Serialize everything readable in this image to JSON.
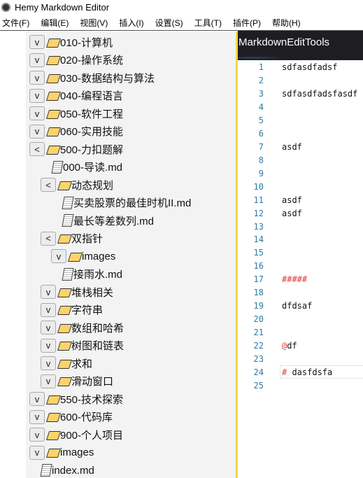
{
  "window": {
    "title": "Hemy Markdown Editor"
  },
  "menu": [
    "文件(F)",
    "编辑(E)",
    "视图(V)",
    "插入(I)",
    "设置(S)",
    "工具(T)",
    "插件(P)",
    "帮助(H)"
  ],
  "tree": [
    {
      "level": 0,
      "type": "folder",
      "toggle": "v",
      "label": "010-计算机"
    },
    {
      "level": 0,
      "type": "folder",
      "toggle": "v",
      "label": "020-操作系统"
    },
    {
      "level": 0,
      "type": "folder",
      "toggle": "v",
      "label": "030-数据结构与算法"
    },
    {
      "level": 0,
      "type": "folder",
      "toggle": "v",
      "label": "040-编程语言"
    },
    {
      "level": 0,
      "type": "folder",
      "toggle": "v",
      "label": "050-软件工程"
    },
    {
      "level": 0,
      "type": "folder",
      "toggle": "v",
      "label": "060-实用技能"
    },
    {
      "level": 0,
      "type": "folder",
      "toggle": "<",
      "label": "500-力扣题解"
    },
    {
      "level": 1,
      "type": "file",
      "label": "000-导读.md"
    },
    {
      "level": 1,
      "type": "folder",
      "toggle": "<",
      "label": "动态规划"
    },
    {
      "level": 2,
      "type": "file",
      "label": "买卖股票的最佳时机II.md"
    },
    {
      "level": 2,
      "type": "file",
      "label": "最长等差数列.md"
    },
    {
      "level": 1,
      "type": "folder",
      "toggle": "<",
      "label": "双指针"
    },
    {
      "level": 2,
      "type": "folder",
      "toggle": "v",
      "label": "images"
    },
    {
      "level": 2,
      "type": "file",
      "label": "接雨水.md"
    },
    {
      "level": 1,
      "type": "folder",
      "toggle": "v",
      "label": "堆栈相关"
    },
    {
      "level": 1,
      "type": "folder",
      "toggle": "v",
      "label": "字符串"
    },
    {
      "level": 1,
      "type": "folder",
      "toggle": "v",
      "label": "数组和哈希"
    },
    {
      "level": 1,
      "type": "folder",
      "toggle": "v",
      "label": "树图和链表"
    },
    {
      "level": 1,
      "type": "folder",
      "toggle": "v",
      "label": "求和"
    },
    {
      "level": 1,
      "type": "folder",
      "toggle": "v",
      "label": "滑动窗口"
    },
    {
      "level": 0,
      "type": "folder",
      "toggle": "v",
      "label": "550-技术探索"
    },
    {
      "level": 0,
      "type": "folder",
      "toggle": "v",
      "label": "600-代码库"
    },
    {
      "level": 0,
      "type": "folder",
      "toggle": "v",
      "label": "900-个人项目"
    },
    {
      "level": 0,
      "type": "folder",
      "toggle": "v",
      "label": "images"
    },
    {
      "level": 0,
      "type": "file",
      "label": "index.md"
    }
  ],
  "editor": {
    "title": "MarkdownEditTools",
    "current_line": 24,
    "lines": [
      {
        "n": "1",
        "text": "sdfasdfadsf"
      },
      {
        "n": "2",
        "text": ""
      },
      {
        "n": "3",
        "text": "sdfasdfadsfasdf"
      },
      {
        "n": "4",
        "text": ""
      },
      {
        "n": "5",
        "text": ""
      },
      {
        "n": "6",
        "text": ""
      },
      {
        "n": "7",
        "text": "asdf"
      },
      {
        "n": "8",
        "text": ""
      },
      {
        "n": "9",
        "text": ""
      },
      {
        "n": "10",
        "text": ""
      },
      {
        "n": "11",
        "text": "asdf"
      },
      {
        "n": "12",
        "text": "asdf"
      },
      {
        "n": "13",
        "text": ""
      },
      {
        "n": "14",
        "text": ""
      },
      {
        "n": "15",
        "text": ""
      },
      {
        "n": "16",
        "text": ""
      },
      {
        "n": "17",
        "mark": "#####",
        "text": ""
      },
      {
        "n": "18",
        "text": ""
      },
      {
        "n": "19",
        "text": "dfdsaf"
      },
      {
        "n": "20",
        "text": ""
      },
      {
        "n": "21",
        "text": ""
      },
      {
        "n": "22",
        "mark": "@",
        "text": "df"
      },
      {
        "n": "23",
        "text": ""
      },
      {
        "n": "24",
        "mark": "#",
        "text": " dasfdsfa"
      },
      {
        "n": "25",
        "text": ""
      }
    ]
  }
}
